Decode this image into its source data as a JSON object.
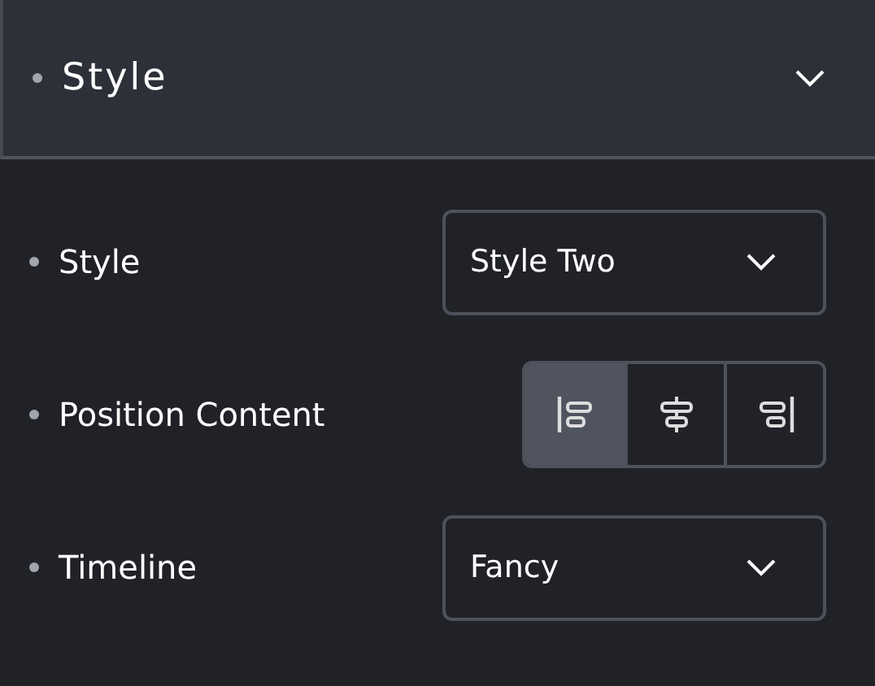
{
  "section": {
    "title": "Style",
    "expanded": true
  },
  "fields": [
    {
      "kind": "select",
      "label": "Style",
      "value": "Style Two"
    },
    {
      "kind": "align",
      "label": "Position Content",
      "options": [
        {
          "selected": true
        },
        {
          "selected": false
        },
        {
          "selected": false
        }
      ]
    },
    {
      "kind": "select",
      "label": "Timeline",
      "value": "Fancy"
    }
  ]
}
